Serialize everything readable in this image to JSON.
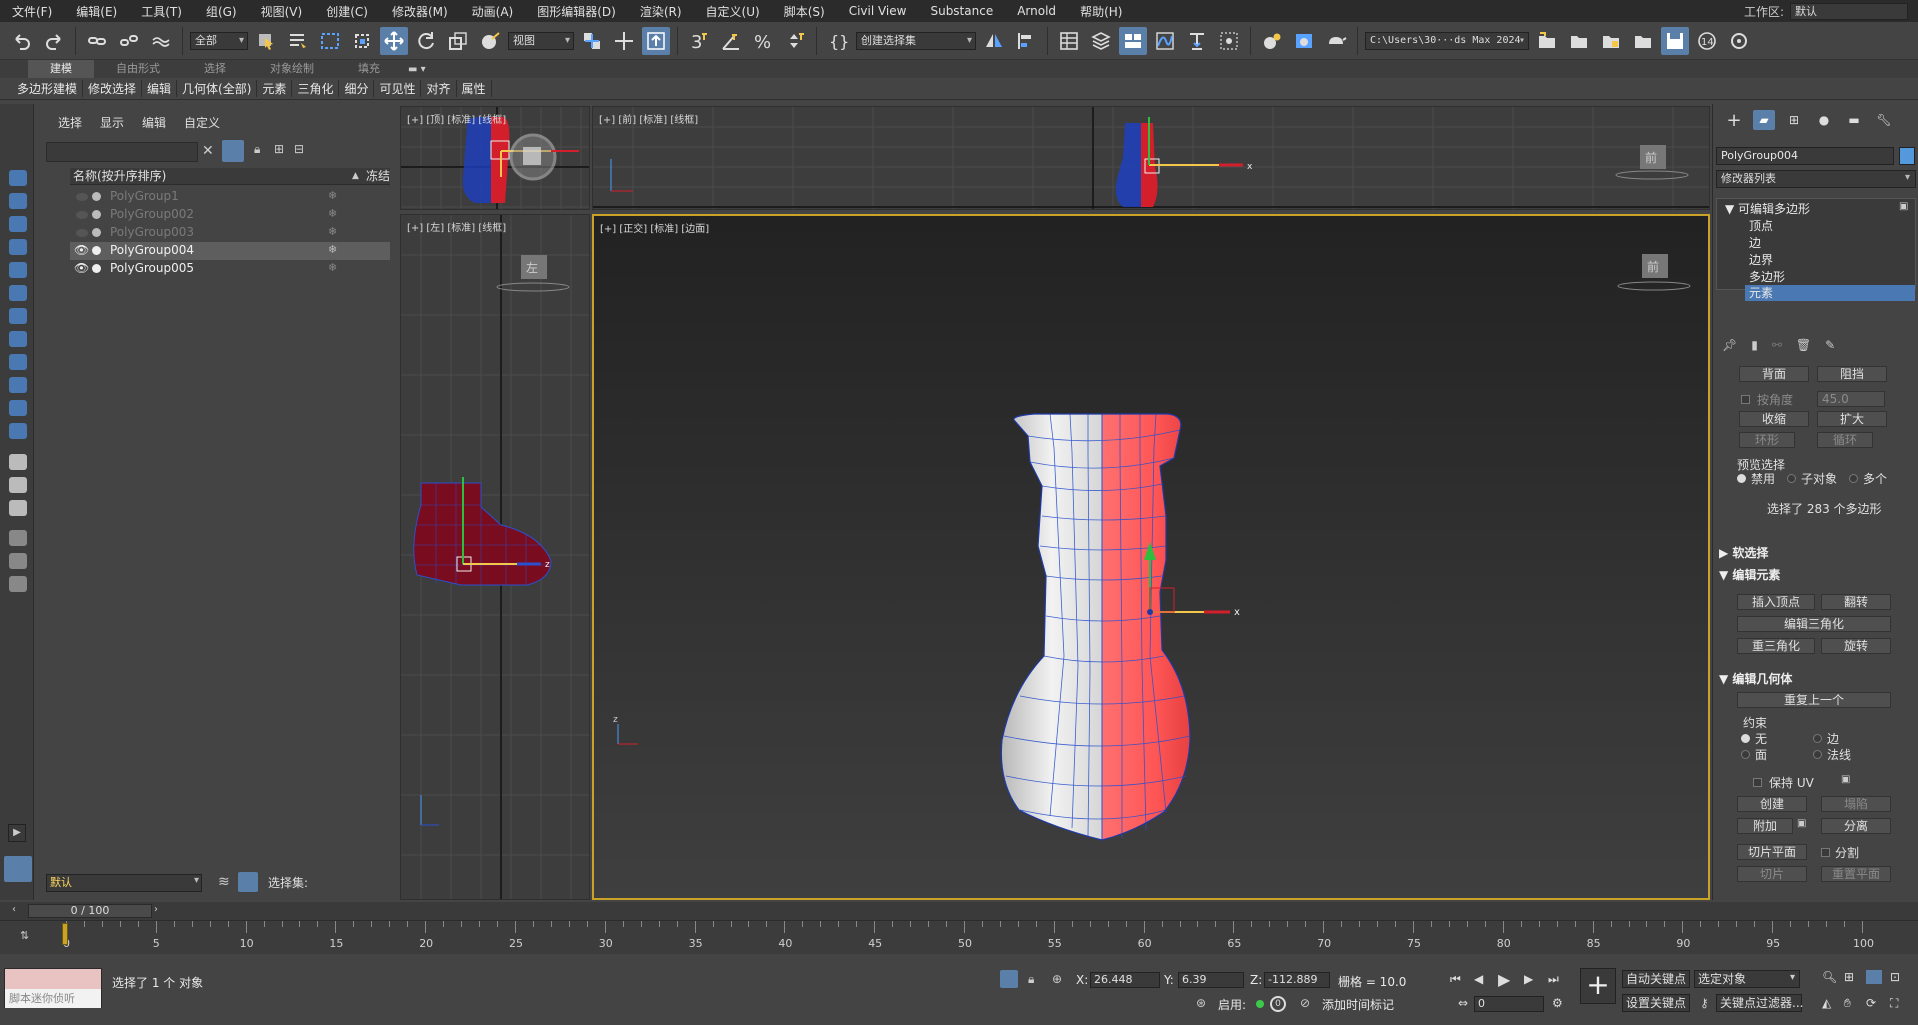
{
  "menu": [
    "文件(F)",
    "编辑(E)",
    "工具(T)",
    "组(G)",
    "视图(V)",
    "创建(C)",
    "修改器(M)",
    "动画(A)",
    "图形编辑器(D)",
    "渲染(R)",
    "自定义(U)",
    "脚本(S)",
    "Civil View",
    "Substance",
    "Arnold",
    "帮助(H)"
  ],
  "workspace": {
    "label": "工作区:",
    "value": "默认"
  },
  "toolbar": {
    "filter_select": "全部",
    "coord_select": "视图",
    "named_selection": "创建选择集",
    "project_path": "C:\\Users\\30···ds Max 2024",
    "badge_14": "14"
  },
  "ribbon": {
    "tabs": [
      "建模",
      "自由形式",
      "选择",
      "对象绘制",
      "填充"
    ],
    "sub": [
      "多边形建模",
      "修改选择",
      "编辑",
      "几何体(全部)",
      "元素",
      "三角化",
      "细分",
      "可见性",
      "对齐",
      "属性"
    ]
  },
  "explorer": {
    "menu": [
      "选择",
      "显示",
      "编辑",
      "自定义"
    ],
    "col_name": "名称(按升序排序)",
    "col_freeze": "冻结",
    "rows": [
      {
        "name": "PolyGroup1"
      },
      {
        "name": "PolyGroup002"
      },
      {
        "name": "PolyGroup003"
      },
      {
        "name": "PolyGroup004"
      },
      {
        "name": "PolyGroup005"
      }
    ],
    "layer": "默认",
    "selection_set_label": "选择集:"
  },
  "viewports": {
    "top": "[+] [顶] [标准] [线框]",
    "front": "[+] [前] [标准] [线框]",
    "left": "[+] [左] [标准] [线框]",
    "persp": "[+] [正交] [标准] [边面]",
    "cube_top": "顶",
    "cube_front": "前",
    "cube_left": "左",
    "cube_persp": "前"
  },
  "command_panel": {
    "object_name": "PolyGroup004",
    "modifier_list": "修改器列表",
    "stack": [
      "可编辑多边形",
      "顶点",
      "边",
      "边界",
      "多边形",
      "元素"
    ],
    "top_btns": [
      "背面",
      "阻挡"
    ],
    "by_angle": "按角度",
    "angle_value": "45.0",
    "shrink": "收缩",
    "grow": "扩大",
    "ring": "环形",
    "loop": "循环",
    "preview_label": "预览选择",
    "preview_opts": [
      "禁用",
      "子对象",
      "多个"
    ],
    "selected_info": "选择了 283 个多边形",
    "soft_select": "软选择",
    "edit_elements": "编辑元素",
    "insert_vertex": "插入顶点",
    "flip": "翻转",
    "edit_tri": "编辑三角化",
    "retriangulate": "重三角化",
    "turn": "旋转",
    "edit_geometry": "编辑几何体",
    "repeat_last": "重复上一个",
    "constraint_label": "约束",
    "constraints": [
      "无",
      "边",
      "面",
      "法线"
    ],
    "preserve_uv": "保持 UV",
    "create": "创建",
    "collapse": "塌陷",
    "attach": "附加",
    "detach": "分离",
    "slice_plane": "切片平面",
    "split": "分割",
    "slice": "切片",
    "reset_plane": "重置平面"
  },
  "timeline": {
    "frame": "0 / 100",
    "ticks": [
      "0",
      "5",
      "10",
      "15",
      "20",
      "25",
      "30",
      "35",
      "40",
      "45",
      "50",
      "55",
      "60",
      "65",
      "70",
      "75",
      "80",
      "85",
      "90",
      "95",
      "100"
    ]
  },
  "status": {
    "maxscript_placeholder": "脚本迷你侦听",
    "selected": "选择了 1 个 对象",
    "x_label": "X:",
    "x": "26.448",
    "y_label": "Y:",
    "y": "6.39",
    "z_label": "Z:",
    "z": "-112.889",
    "grid": "栅格 = 10.0",
    "enable": "启用:",
    "add_time_tag": "添加时间标记",
    "auto_key": "自动关键点",
    "set_key": "设置关键点",
    "selected_object": "选定对象",
    "key_filters": "关键点过滤器...",
    "frame_field": "0"
  },
  "colors": {
    "accent": "#5a7fa8",
    "selection_red": "#ff5a5a",
    "wire_blue": "#2a50d0",
    "active_border": "#c9a227"
  }
}
